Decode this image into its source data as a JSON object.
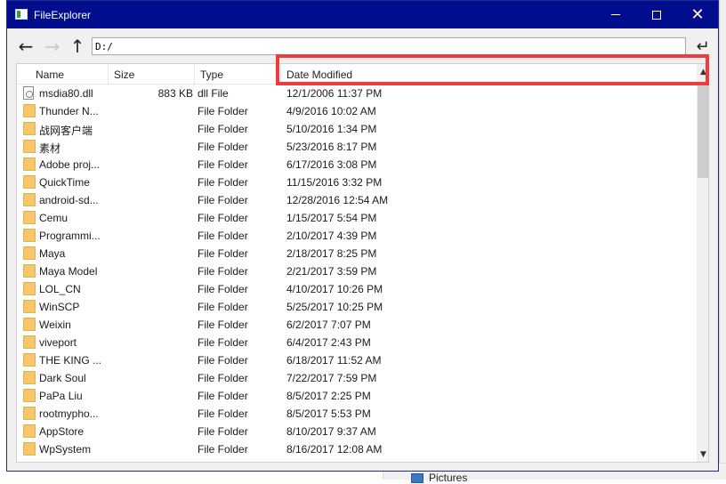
{
  "window": {
    "title": "FileExplorer"
  },
  "nav": {
    "address": "D:/"
  },
  "columns": {
    "name": "Name",
    "size": "Size",
    "type": "Type",
    "date": "Date Modified"
  },
  "rows": [
    {
      "icon": "dll-file-icon",
      "name": "msdia80.dll",
      "size": "883 KB",
      "type": "dll File",
      "date": "12/1/2006 11:37 PM"
    },
    {
      "icon": "folder-icon",
      "name": "Thunder N...",
      "size": "",
      "type": "File Folder",
      "date": "4/9/2016 10:02 AM"
    },
    {
      "icon": "folder-icon",
      "name": "战网客户端",
      "size": "",
      "type": "File Folder",
      "date": "5/10/2016 1:34 PM"
    },
    {
      "icon": "folder-icon",
      "name": "素材",
      "size": "",
      "type": "File Folder",
      "date": "5/23/2016 8:17 PM"
    },
    {
      "icon": "folder-icon",
      "name": "Adobe proj...",
      "size": "",
      "type": "File Folder",
      "date": "6/17/2016 3:08 PM"
    },
    {
      "icon": "folder-icon",
      "name": "QuickTime",
      "size": "",
      "type": "File Folder",
      "date": "11/15/2016 3:32 PM"
    },
    {
      "icon": "folder-icon",
      "name": "android-sd...",
      "size": "",
      "type": "File Folder",
      "date": "12/28/2016 12:54 AM"
    },
    {
      "icon": "folder-icon",
      "name": "Cemu",
      "size": "",
      "type": "File Folder",
      "date": "1/15/2017 5:54 PM"
    },
    {
      "icon": "folder-icon",
      "name": "Programmi...",
      "size": "",
      "type": "File Folder",
      "date": "2/10/2017 4:39 PM"
    },
    {
      "icon": "folder-icon",
      "name": "Maya",
      "size": "",
      "type": "File Folder",
      "date": "2/18/2017 8:25 PM"
    },
    {
      "icon": "folder-icon",
      "name": "Maya Model",
      "size": "",
      "type": "File Folder",
      "date": "2/21/2017 3:59 PM"
    },
    {
      "icon": "folder-icon",
      "name": "LOL_CN",
      "size": "",
      "type": "File Folder",
      "date": "4/10/2017 10:26 PM"
    },
    {
      "icon": "folder-icon",
      "name": "WinSCP",
      "size": "",
      "type": "File Folder",
      "date": "5/25/2017 10:25 PM"
    },
    {
      "icon": "folder-icon",
      "name": "Weixin",
      "size": "",
      "type": "File Folder",
      "date": "6/2/2017 7:07 PM"
    },
    {
      "icon": "folder-icon",
      "name": "viveport",
      "size": "",
      "type": "File Folder",
      "date": "6/4/2017 2:43 PM"
    },
    {
      "icon": "folder-icon",
      "name": "THE KING ...",
      "size": "",
      "type": "File Folder",
      "date": "6/18/2017 11:52 AM"
    },
    {
      "icon": "folder-icon",
      "name": "Dark Soul",
      "size": "",
      "type": "File Folder",
      "date": "7/22/2017 7:59 PM"
    },
    {
      "icon": "folder-icon",
      "name": "PaPa Liu",
      "size": "",
      "type": "File Folder",
      "date": "8/5/2017 2:25 PM"
    },
    {
      "icon": "folder-icon",
      "name": "rootmypho...",
      "size": "",
      "type": "File Folder",
      "date": "8/5/2017 5:53 PM"
    },
    {
      "icon": "folder-icon",
      "name": "AppStore",
      "size": "",
      "type": "File Folder",
      "date": "8/10/2017 9:37 AM"
    },
    {
      "icon": "folder-icon",
      "name": "WpSystem",
      "size": "",
      "type": "File Folder",
      "date": "8/16/2017 12:08 AM"
    }
  ],
  "background": {
    "pictures_label": "Pictures"
  }
}
